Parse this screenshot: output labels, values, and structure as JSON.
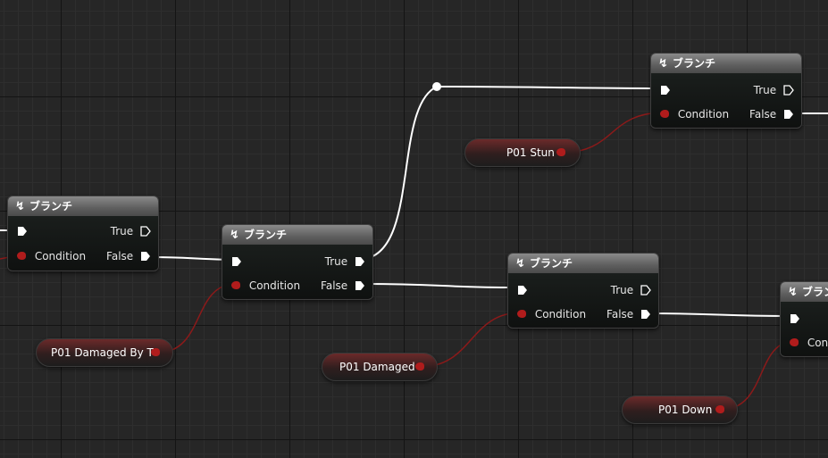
{
  "branch_nodes": [
    {
      "id": "n1",
      "title": "ブランチ",
      "in_condition": "Condition",
      "out_true": "True",
      "out_false": "False"
    },
    {
      "id": "n2",
      "title": "ブランチ",
      "in_condition": "Condition",
      "out_true": "True",
      "out_false": "False"
    },
    {
      "id": "n3",
      "title": "ブランチ",
      "in_condition": "Condition",
      "out_true": "True",
      "out_false": "False"
    },
    {
      "id": "n4",
      "title": "ブランチ",
      "in_condition": "Condition",
      "out_true": "True",
      "out_false": "False"
    },
    {
      "id": "n5",
      "title": "ブランチ",
      "in_condition": "Conc"
    }
  ],
  "variable_nodes": [
    {
      "id": "v1",
      "label": "P01 Stun"
    },
    {
      "id": "v2",
      "label": "P01 Damaged By T"
    },
    {
      "id": "v3",
      "label": "P01 Damaged"
    },
    {
      "id": "v4",
      "label": "P01 Down"
    }
  ],
  "colors": {
    "grid_bg": "#262626",
    "exec_wire": "#ffffff",
    "bool_wire": "#8b1a1a",
    "bool_pin": "#b01c1c",
    "node_header": "#6a6a6a"
  },
  "icons": {
    "branch": "branch-icon",
    "exec_pin": "exec-pin-icon",
    "bool_pin": "bool-pin-icon",
    "reroute": "reroute-knot-icon"
  }
}
